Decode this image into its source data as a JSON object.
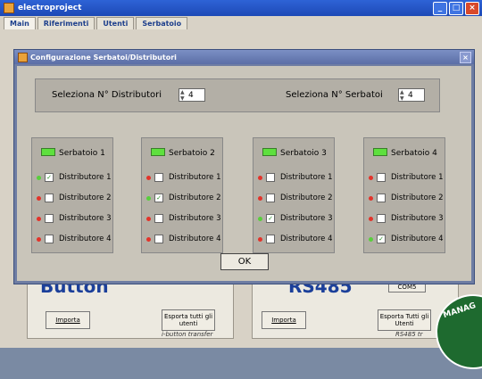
{
  "window": {
    "title": "electroproject"
  },
  "tabs": [
    "Main",
    "Riferimenti",
    "Utenti",
    "Serbatoio"
  ],
  "dialog": {
    "title": "Configurazione Serbatoi/Distributori",
    "distributori_label": "Seleziona N° Distributori",
    "distributori_value": "4",
    "serbatoi_label": "Seleziona N° Serbatoi",
    "serbatoi_value": "4",
    "ok_label": "OK",
    "tanks": [
      {
        "name": "Serbatoio 1",
        "rows": [
          {
            "label": "Distributore 1",
            "checked": true,
            "status": "green"
          },
          {
            "label": "Distributore 2",
            "checked": false,
            "status": "red"
          },
          {
            "label": "Distributore 3",
            "checked": false,
            "status": "red"
          },
          {
            "label": "Distributore 4",
            "checked": false,
            "status": "red"
          }
        ]
      },
      {
        "name": "Serbatoio 2",
        "rows": [
          {
            "label": "Distributore 1",
            "checked": false,
            "status": "red"
          },
          {
            "label": "Distributore 2",
            "checked": true,
            "status": "green"
          },
          {
            "label": "Distributore 3",
            "checked": false,
            "status": "red"
          },
          {
            "label": "Distributore 4",
            "checked": false,
            "status": "red"
          }
        ]
      },
      {
        "name": "Serbatoio 3",
        "rows": [
          {
            "label": "Distributore 1",
            "checked": false,
            "status": "red"
          },
          {
            "label": "Distributore 2",
            "checked": false,
            "status": "red"
          },
          {
            "label": "Distributore 3",
            "checked": true,
            "status": "green"
          },
          {
            "label": "Distributore 4",
            "checked": false,
            "status": "red"
          }
        ]
      },
      {
        "name": "Serbatoio 4",
        "rows": [
          {
            "label": "Distributore 1",
            "checked": false,
            "status": "red"
          },
          {
            "label": "Distributore 2",
            "checked": false,
            "status": "red"
          },
          {
            "label": "Distributore 3",
            "checked": false,
            "status": "red"
          },
          {
            "label": "Distributore 4",
            "checked": true,
            "status": "green"
          }
        ]
      }
    ]
  },
  "background": {
    "left_logo": "Button",
    "left_import": "Importa",
    "left_export": "Esporta tutti gli utenti",
    "left_caption": "i-button transfer",
    "right_logo": "RS485",
    "right_select": "COM5",
    "right_import": "Importa",
    "right_export": "Esporta Tutti gli Utenti",
    "right_caption": "RS485 tr",
    "badge": "MANAG"
  },
  "colors": {
    "led_green": "#5ee03e",
    "status_red": "#e3332a",
    "status_green": "#58cf3c"
  }
}
